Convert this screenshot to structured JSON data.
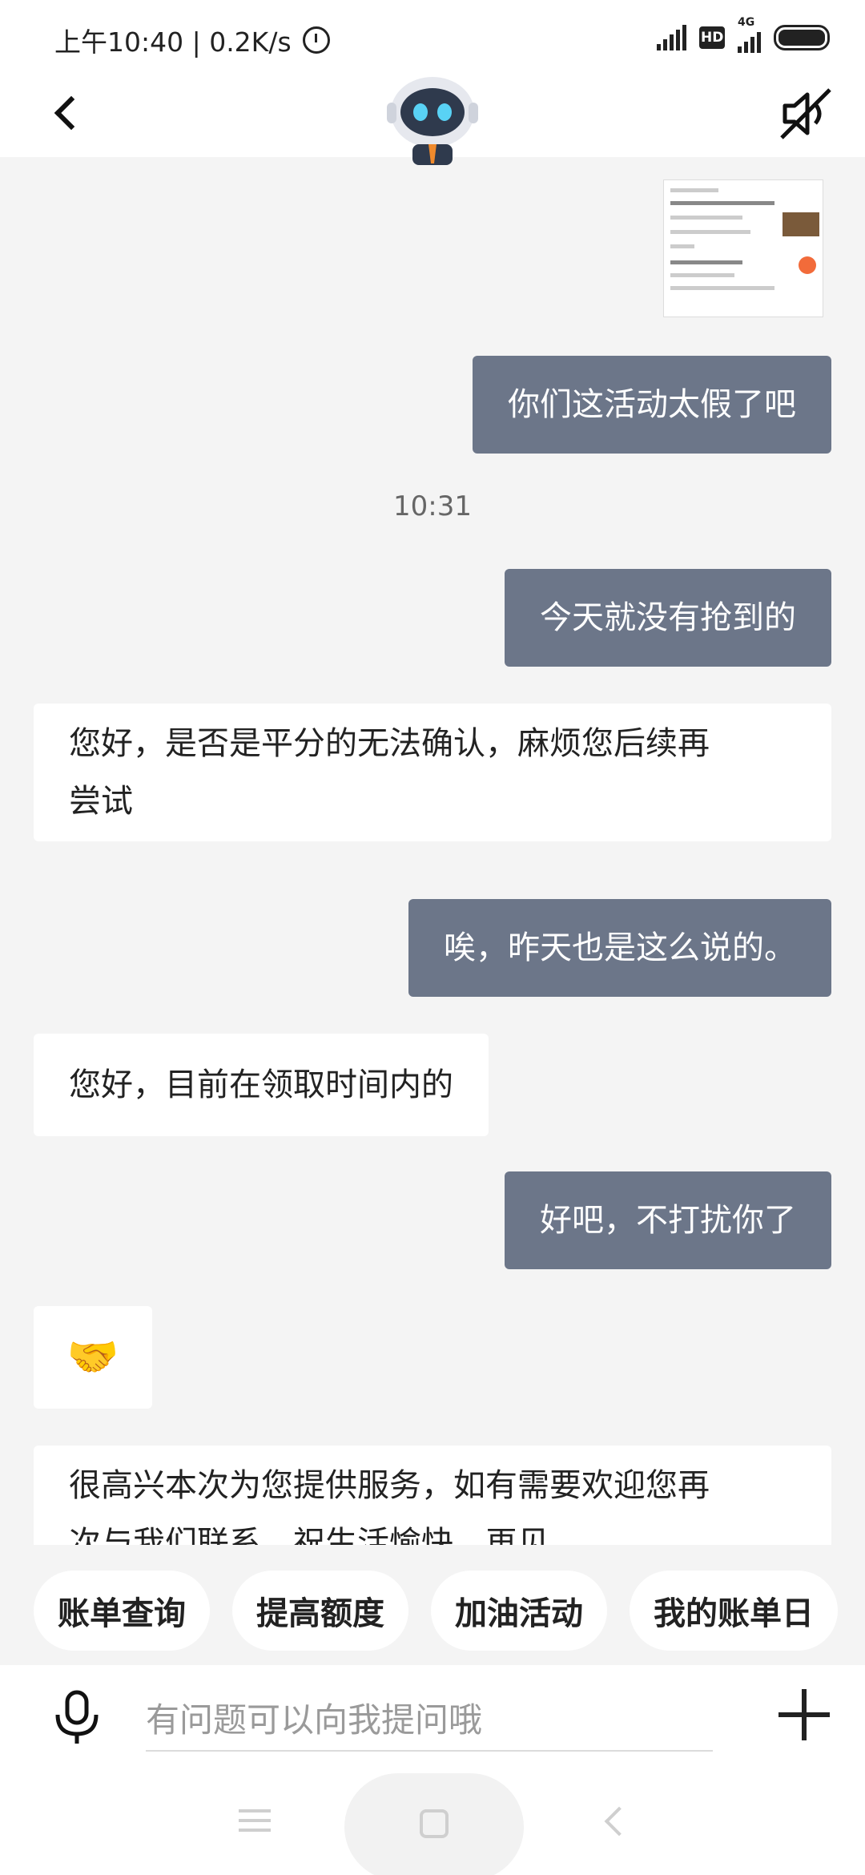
{
  "status_bar": {
    "time_speed": "上午10:40 | 0.2K/s",
    "hd_label": "HD",
    "network": "4G"
  },
  "header": {
    "avatar_icon": "robot-avatar-icon",
    "mute_icon": "speaker-mute-icon"
  },
  "messages": [
    {
      "type": "image",
      "side": "out"
    },
    {
      "type": "text",
      "side": "out",
      "text": "你们这活动太假了吧"
    },
    {
      "type": "time",
      "text": "10:31"
    },
    {
      "type": "text",
      "side": "out",
      "text": "今天就没有抢到的"
    },
    {
      "type": "text",
      "side": "in",
      "line1": "您好，是否是平分的无法确认，麻烦您后续再",
      "line2": "尝试"
    },
    {
      "type": "text",
      "side": "out",
      "text": "唉，昨天也是这么说的。"
    },
    {
      "type": "text",
      "side": "in",
      "text": "您好，目前在领取时间内的"
    },
    {
      "type": "text",
      "side": "out",
      "text": "好吧，不打扰你了"
    },
    {
      "type": "emoji",
      "side": "in",
      "text": "🤝"
    },
    {
      "type": "text",
      "side": "in",
      "line1": "很高兴本次为您提供服务，如有需要欢迎您再",
      "line2": "次与我们联系，祝生活愉快，再见"
    }
  ],
  "quick_replies": [
    "账单查询",
    "提高额度",
    "加油活动",
    "我的账单日"
  ],
  "input": {
    "placeholder": "有问题可以向我提问哦",
    "value": ""
  },
  "colors": {
    "outgoing_bubble": "#6c7689",
    "incoming_bubble": "#ffffff",
    "chat_background": "#f4f4f4"
  }
}
